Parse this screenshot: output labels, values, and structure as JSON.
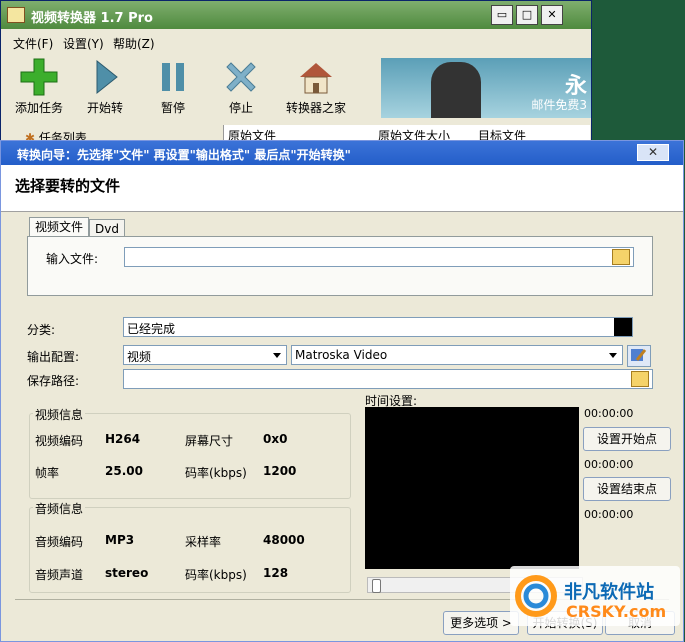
{
  "bg_window": {
    "title": "视频转换器 1.7 Pro",
    "controls": [
      "▭",
      "□",
      "✕"
    ],
    "menu": [
      "文件(F)",
      "设置(Y)",
      "帮助(Z)"
    ],
    "toolbar": [
      {
        "label": "添加任务",
        "icon": "add-icon"
      },
      {
        "label": "开始转",
        "icon": "play-icon"
      },
      {
        "label": "暂停",
        "icon": "pause-icon"
      },
      {
        "label": "停止",
        "icon": "stop-icon"
      },
      {
        "label": "转换器之家",
        "icon": "home-icon"
      }
    ],
    "banner": {
      "big": "永",
      "small": "邮件免费3"
    },
    "tree_label": "任务列表",
    "columns": [
      "原始文件",
      "原始文件大小",
      "目标文件"
    ]
  },
  "dialog": {
    "title": "转换向导：先选择\"文件\" 再设置\"输出格式\" 最后点\"开始转换\"",
    "close": "✕",
    "heading": "选择要转的文件",
    "tabs": [
      "视频文件",
      "Dvd"
    ],
    "input_label": "输入文件:",
    "input_value": "",
    "category_label": "分类:",
    "category_value": "已经完成",
    "output_label": "输出配置:",
    "output_type": "视频",
    "output_format": "Matroska Video",
    "save_label": "保存路径:",
    "save_value": "",
    "video_info": {
      "title": "视频信息",
      "codec_label": "视频编码",
      "codec": "H264",
      "size_label": "屏幕尺寸",
      "size": "0x0",
      "fps_label": "帧率",
      "fps": "25.00",
      "bitrate_label": "码率(kbps)",
      "bitrate": "1200"
    },
    "audio_info": {
      "title": "音频信息",
      "codec_label": "音频编码",
      "codec": "MP3",
      "rate_label": "采样率",
      "rate": "48000",
      "channel_label": "音频声道",
      "channel": "stereo",
      "bitrate_label": "码率(kbps)",
      "bitrate": "128"
    },
    "time": {
      "title": "时间设置:",
      "t1": "00:00:00",
      "t2": "00:00:00",
      "t3": "00:00:00",
      "set_start": "设置开始点",
      "set_end": "设置结束点"
    },
    "buttons": {
      "more": "更多选项 >",
      "start": "开始转换(S)",
      "cancel": "取消"
    }
  },
  "watermark": {
    "cn": "非凡软件站",
    "en": "CRSKY.com"
  }
}
